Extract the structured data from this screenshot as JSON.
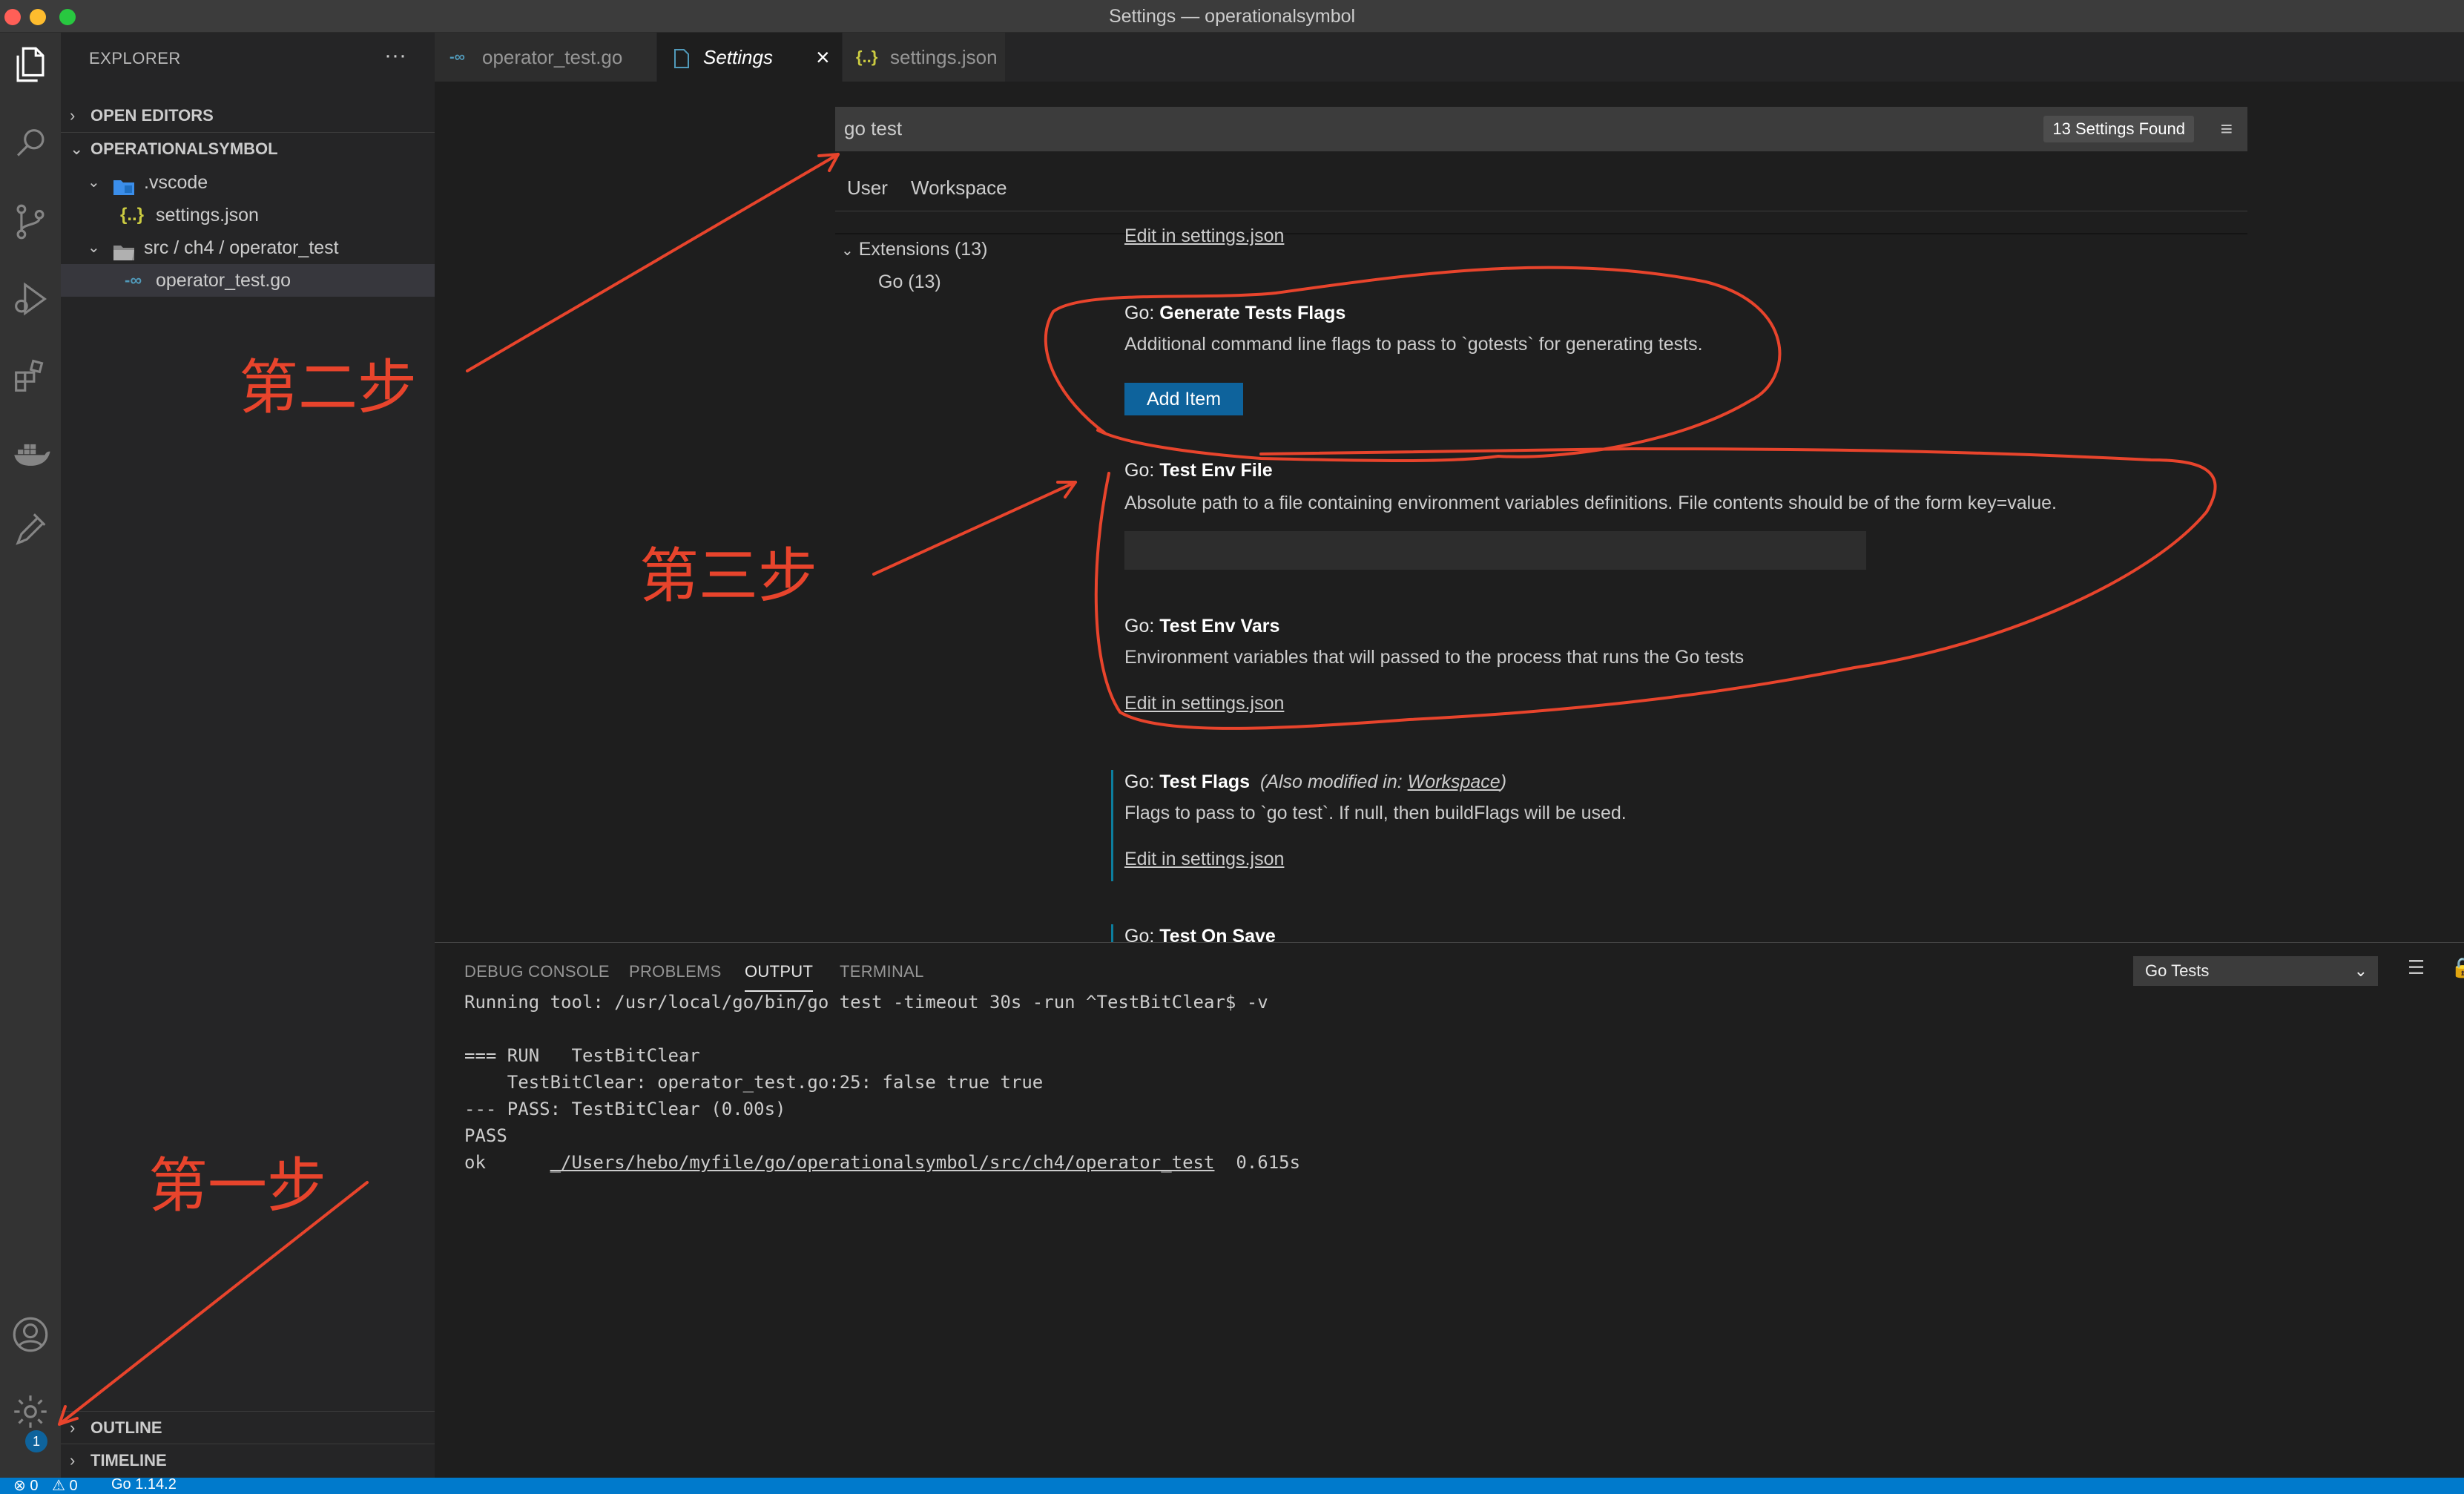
{
  "window": {
    "title": "Settings — operationalsymbol"
  },
  "sidebar": {
    "header": "EXPLORER",
    "more_icon": "ellipsis-icon",
    "sections": {
      "open_editors": "OPEN EDITORS",
      "workspace": "OPERATIONALSYMBOL",
      "outline": "OUTLINE",
      "timeline": "TIMELINE"
    },
    "tree": [
      {
        "label": ".vscode",
        "type": "folder",
        "expanded": true
      },
      {
        "label": "settings.json",
        "type": "json-file"
      },
      {
        "label": "src / ch4 / operator_test",
        "type": "folder",
        "expanded": true
      },
      {
        "label": "operator_test.go",
        "type": "go-file",
        "selected": true
      }
    ]
  },
  "activity_bar": {
    "icons": [
      "files-icon",
      "search-icon",
      "source-control-icon",
      "run-debug-icon",
      "extensions-icon",
      "docker-icon",
      "testing-flask-icon",
      "account-icon",
      "gear-icon"
    ],
    "gear_badge": "1"
  },
  "tabs": [
    {
      "label": "operator_test.go",
      "icon": "go-file-icon",
      "active": false
    },
    {
      "label": "Settings",
      "icon": "settings-file-icon",
      "active": true,
      "close": "×"
    },
    {
      "label": "settings.json",
      "icon": "json-file-icon",
      "active": false
    }
  ],
  "settings": {
    "search_value": "go test",
    "found_count": "13 Settings Found",
    "scopes": [
      "User",
      "Workspace"
    ],
    "toc": {
      "extensions": "Extensions (13)",
      "go": "Go (13)"
    },
    "edit_link": "Edit in settings.json",
    "items": [
      {
        "prefix": "Go: ",
        "name": "Generate Tests Flags",
        "description": "Additional command line flags to pass to `gotests` for generating tests.",
        "button": "Add Item"
      },
      {
        "prefix": "Go: ",
        "name": "Test Env File",
        "description": "Absolute path to a file containing environment variables definitions. File contents should be of the form key=value.",
        "input_value": ""
      },
      {
        "prefix": "Go: ",
        "name": "Test Env Vars",
        "description": "Environment variables that will passed to the process that runs the Go tests",
        "link": "Edit in settings.json"
      },
      {
        "prefix": "Go: ",
        "name": "Test Flags",
        "modified_note": "(Also modified in: ",
        "modified_scope": "Workspace",
        "modified_close": ")",
        "description": "Flags to pass to `go test`. If null, then buildFlags will be used.",
        "link": "Edit in settings.json"
      },
      {
        "prefix": "Go: ",
        "name": "Test On Save"
      }
    ]
  },
  "panel": {
    "tabs": [
      "DEBUG CONSOLE",
      "PROBLEMS",
      "OUTPUT",
      "TERMINAL"
    ],
    "active_tab": "OUTPUT",
    "channel": "Go Tests",
    "output": [
      "Running tool: /usr/local/go/bin/go test -timeout 30s -run ^TestBitClear$ -v",
      "",
      "=== RUN   TestBitClear",
      "    TestBitClear: operator_test.go:25: false true true",
      "--- PASS: TestBitClear (0.00s)",
      "PASS"
    ],
    "ok_prefix": "ok      ",
    "ok_path": "_/Users/hebo/myfile/go/operationalsymbol/src/ch4/operator_test",
    "ok_time": "  0.615s"
  },
  "status_bar": {
    "errors": "⊗ 0",
    "warnings": "⚠ 0",
    "go_version": "Go 1.14.2",
    "background": "#007acc"
  },
  "annotations": {
    "step1": "第一步",
    "step2": "第二步",
    "step3": "第三步",
    "color": "#e8442c"
  }
}
